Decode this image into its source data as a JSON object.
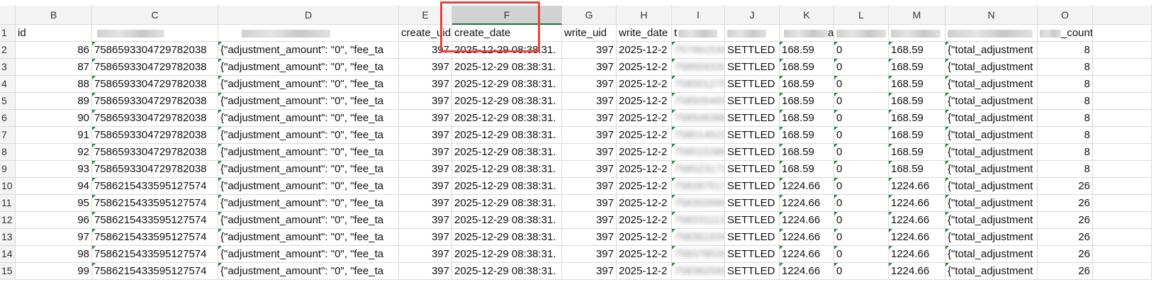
{
  "columns": [
    "",
    "B",
    "C",
    "D",
    "E",
    "F",
    "G",
    "H",
    "I",
    "J",
    "K",
    "L",
    "M",
    "N",
    "O",
    ""
  ],
  "header_row": {
    "row_num": "1",
    "cells": [
      "id",
      "",
      "",
      "create_uid",
      "create_date",
      "write_uid",
      "write_date",
      "t",
      "",
      "",
      "a",
      "",
      "",
      "_count"
    ]
  },
  "rows": [
    {
      "row_num": "2",
      "id": "86",
      "ref": "7586593304729782038",
      "json": "{\"adjustment_amount\": \"0\", \"fee_ta",
      "cuid": "397",
      "cdate": "2025-12-29 08:38:31.",
      "wuid": "397",
      "wdate": "2025-12-2",
      "tid": "757991534",
      "status": "SETTLED",
      "k": "168.59",
      "l": "0",
      "m": "168.59",
      "n": "{\"total_adjustment",
      "count": "8"
    },
    {
      "row_num": "3",
      "id": "87",
      "ref": "7586593304729782038",
      "json": "{\"adjustment_amount\": \"0\", \"fee_ta",
      "cuid": "397",
      "cdate": "2025-12-29 08:38:31.",
      "wuid": "397",
      "wdate": "2025-12-2",
      "tid": "75865933C",
      "status": "SETTLED",
      "k": "168.59",
      "l": "0",
      "m": "168.59",
      "n": "{\"total_adjustment",
      "count": "8"
    },
    {
      "row_num": "4",
      "id": "88",
      "ref": "7586593304729782038",
      "json": "{\"adjustment_amount\": \"0\", \"fee_ta",
      "cuid": "397",
      "cdate": "2025-12-29 08:38:31.",
      "wuid": "397",
      "wdate": "2025-12-2",
      "tid": "758501275",
      "status": "SETTLED",
      "k": "168.59",
      "l": "0",
      "m": "168.59",
      "n": "{\"total_adjustment",
      "count": "8"
    },
    {
      "row_num": "5",
      "id": "89",
      "ref": "7586593304729782038",
      "json": "{\"adjustment_amount\": \"0\", \"fee_ta",
      "cuid": "397",
      "cdate": "2025-12-29 08:38:31.",
      "wuid": "397",
      "wdate": "2025-12-2",
      "tid": "758505465",
      "status": "SETTLED",
      "k": "168.59",
      "l": "0",
      "m": "168.59",
      "n": "{\"total_adjustment",
      "count": "8"
    },
    {
      "row_num": "6",
      "id": "90",
      "ref": "7586593304729782038",
      "json": "{\"adjustment_amount\": \"0\", \"fee_ta",
      "cuid": "397",
      "cdate": "2025-12-29 08:38:31.",
      "wuid": "397",
      "wdate": "2025-12-2",
      "tid": "758506388",
      "status": "SETTLED",
      "k": "168.59",
      "l": "0",
      "m": "168.59",
      "n": "{\"total_adjustment",
      "count": "8"
    },
    {
      "row_num": "7",
      "id": "91",
      "ref": "7586593304729782038",
      "json": "{\"adjustment_amount\": \"0\", \"fee_ta",
      "cuid": "397",
      "cdate": "2025-12-29 08:38:31.",
      "wuid": "397",
      "wdate": "2025-12-2",
      "tid": "758514523",
      "status": "SETTLED",
      "k": "168.59",
      "l": "0",
      "m": "168.59",
      "n": "{\"total_adjustment",
      "count": "8"
    },
    {
      "row_num": "8",
      "id": "92",
      "ref": "7586593304729782038",
      "json": "{\"adjustment_amount\": \"0\", \"fee_ta",
      "cuid": "397",
      "cdate": "2025-12-29 08:38:31.",
      "wuid": "397",
      "wdate": "2025-12-2",
      "tid": "758515389",
      "status": "SETTLED",
      "k": "168.59",
      "l": "0",
      "m": "168.59",
      "n": "{\"total_adjustment",
      "count": "8"
    },
    {
      "row_num": "9",
      "id": "93",
      "ref": "7586593304729782038",
      "json": "{\"adjustment_amount\": \"0\", \"fee_ta",
      "cuid": "397",
      "cdate": "2025-12-29 08:38:31.",
      "wuid": "397",
      "wdate": "2025-12-2",
      "tid": "758523173",
      "status": "SETTLED",
      "k": "168.59",
      "l": "0",
      "m": "168.59",
      "n": "{\"total_adjustment",
      "count": "8"
    },
    {
      "row_num": "10",
      "id": "94",
      "ref": "7586215433595127574",
      "json": "{\"adjustment_amount\": \"0\", \"fee_ta",
      "cuid": "397",
      "cdate": "2025-12-29 08:38:31.",
      "wuid": "397",
      "wdate": "2025-12-2",
      "tid": "758287517",
      "status": "SETTLED",
      "k": "1224.66",
      "l": "0",
      "m": "1224.66",
      "n": "{\"total_adjustment",
      "count": "26"
    },
    {
      "row_num": "11",
      "id": "95",
      "ref": "7586215433595127574",
      "json": "{\"adjustment_amount\": \"0\", \"fee_ta",
      "cuid": "397",
      "cdate": "2025-12-29 08:38:31.",
      "wuid": "397",
      "wdate": "2025-12-2",
      "tid": "758302680",
      "status": "SETTLED",
      "k": "1224.66",
      "l": "0",
      "m": "1224.66",
      "n": "{\"total_adjustment",
      "count": "26"
    },
    {
      "row_num": "12",
      "id": "96",
      "ref": "7586215433595127574",
      "json": "{\"adjustment_amount\": \"0\", \"fee_ta",
      "cuid": "397",
      "cdate": "2025-12-29 08:38:31.",
      "wuid": "397",
      "wdate": "2025-12-2",
      "tid": "758331113",
      "status": "SETTLED",
      "k": "1224.66",
      "l": "0",
      "m": "1224.66",
      "n": "{\"total_adjustment",
      "count": "26"
    },
    {
      "row_num": "13",
      "id": "97",
      "ref": "7586215433595127574",
      "json": "{\"adjustment_amount\": \"0\", \"fee_ta",
      "cuid": "397",
      "cdate": "2025-12-29 08:38:31.",
      "wuid": "397",
      "wdate": "2025-12-2",
      "tid": "758361934",
      "status": "SETTLED",
      "k": "1224.66",
      "l": "0",
      "m": "1224.66",
      "n": "{\"total_adjustment",
      "count": "26"
    },
    {
      "row_num": "14",
      "id": "98",
      "ref": "7586215433595127574",
      "json": "{\"adjustment_amount\": \"0\", \"fee_ta",
      "cuid": "397",
      "cdate": "2025-12-29 08:38:31.",
      "wuid": "397",
      "wdate": "2025-12-2",
      "tid": "758378533",
      "status": "SETTLED",
      "k": "1224.66",
      "l": "0",
      "m": "1224.66",
      "n": "{\"total_adjustment",
      "count": "26"
    },
    {
      "row_num": "15",
      "id": "99",
      "ref": "7586215433595127574",
      "json": "{\"adjustment_amount\": \"0\", \"fee_ta",
      "cuid": "397",
      "cdate": "2025-12-29 08:38:31.",
      "wuid": "397",
      "wdate": "2025-12-2",
      "tid": "758382569",
      "status": "SETTLED",
      "k": "1224.66",
      "l": "0",
      "m": "1224.66",
      "n": "{\"total_adjustment",
      "count": "26"
    }
  ],
  "colors": {
    "highlight": "#e8423f",
    "selected_header": "#d2d2d2",
    "header_bg": "#f3f3f3",
    "grid_line": "#d9d9d9",
    "number_marker": "#1e8a3c"
  }
}
